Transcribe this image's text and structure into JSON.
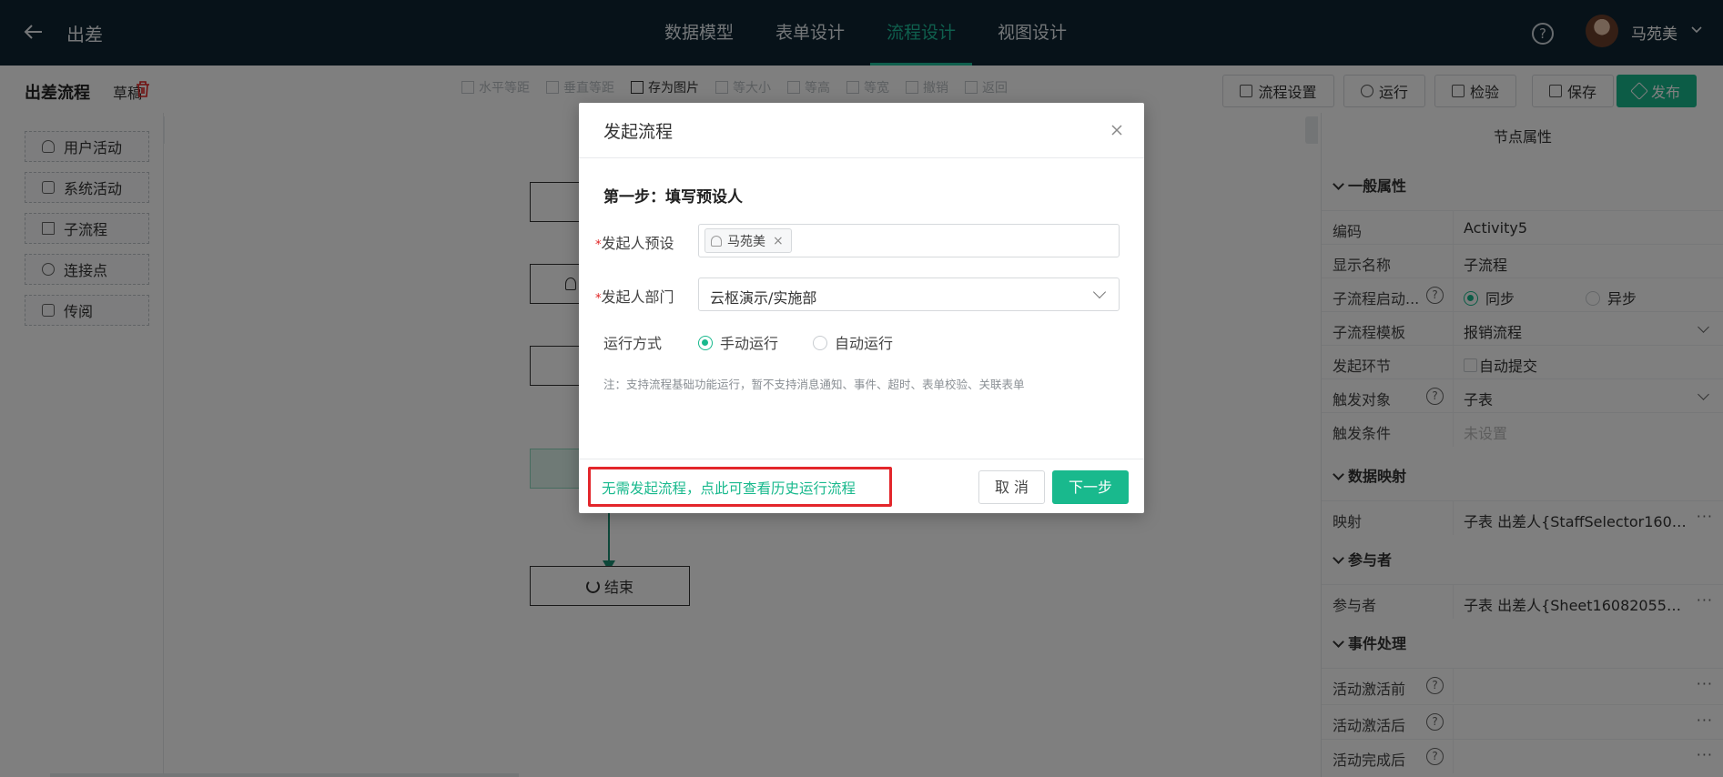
{
  "topbar": {
    "title": "出差",
    "tabs": [
      {
        "label": "数据模型",
        "active": false
      },
      {
        "label": "表单设计",
        "active": false
      },
      {
        "label": "流程设计",
        "active": true
      },
      {
        "label": "视图设计",
        "active": false
      }
    ],
    "help": "?",
    "username": "马苑美",
    "accent_color": "#1ebf9b",
    "bg_color": "#0f2533"
  },
  "toolbar": {
    "flow_name": "出差流程",
    "status": "草稿",
    "tools": [
      {
        "label": "水平等距",
        "enabled": false
      },
      {
        "label": "垂直等距",
        "enabled": false
      },
      {
        "label": "存为图片",
        "enabled": true
      },
      {
        "label": "等大小",
        "enabled": false
      },
      {
        "label": "等高",
        "enabled": false
      },
      {
        "label": "等宽",
        "enabled": false
      },
      {
        "label": "撤销",
        "enabled": false
      },
      {
        "label": "返回",
        "enabled": false
      }
    ],
    "buttons": {
      "settings": "流程设置",
      "run": "运行",
      "check": "检验",
      "save": "保存",
      "publish": "发布"
    }
  },
  "palette": [
    {
      "label": "用户活动",
      "icon": "user-icon"
    },
    {
      "label": "系统活动",
      "icon": "grid-icon"
    },
    {
      "label": "子流程",
      "icon": "subflow-icon"
    },
    {
      "label": "连接点",
      "icon": "link-icon"
    },
    {
      "label": "传阅",
      "icon": "document-icon"
    }
  ],
  "canvas": {
    "end_node": "结束"
  },
  "properties": {
    "title": "节点属性",
    "general": {
      "heading": "一般属性",
      "code_label": "编码",
      "code_value": "Activity5",
      "display_label": "显示名称",
      "display_value": "子流程",
      "start_label": "子流程启动...",
      "start_sync": "同步",
      "start_async": "异步",
      "template_label": "子流程模板",
      "template_value": "报销流程",
      "trigger_step_label": "发起环节",
      "trigger_step_value": "自动提交",
      "trigger_obj_label": "触发对象",
      "trigger_obj_value": "子表",
      "trigger_cond_label": "触发条件",
      "trigger_cond_value": "未设置"
    },
    "mapping": {
      "heading": "数据映射",
      "label": "映射",
      "value": "子表 出差人{StaffSelector1608205..."
    },
    "participants": {
      "heading": "参与者",
      "label": "参与者",
      "value": "子表 出差人{Sheet160820554522..."
    },
    "events": {
      "heading": "事件处理",
      "before_label": "活动激活前",
      "after_label": "活动激活后",
      "complete_label": "活动完成后"
    },
    "more": "···"
  },
  "modal": {
    "title": "发起流程",
    "step": "第一步：填写预设人",
    "initiator_label": "发起人预设",
    "initiator_tag": "马苑美",
    "dept_label": "发起人部门",
    "dept_value": "云枢演示/实施部",
    "mode_label": "运行方式",
    "mode_manual": "手动运行",
    "mode_auto": "自动运行",
    "note": "注：支持流程基础功能运行，暂不支持消息通知、事件、超时、表单校验、关联表单",
    "history_link": "无需发起流程，点此可查看历史运行流程",
    "cancel": "取 消",
    "next": "下一步",
    "required_mark": "*",
    "tag_close": "×"
  }
}
